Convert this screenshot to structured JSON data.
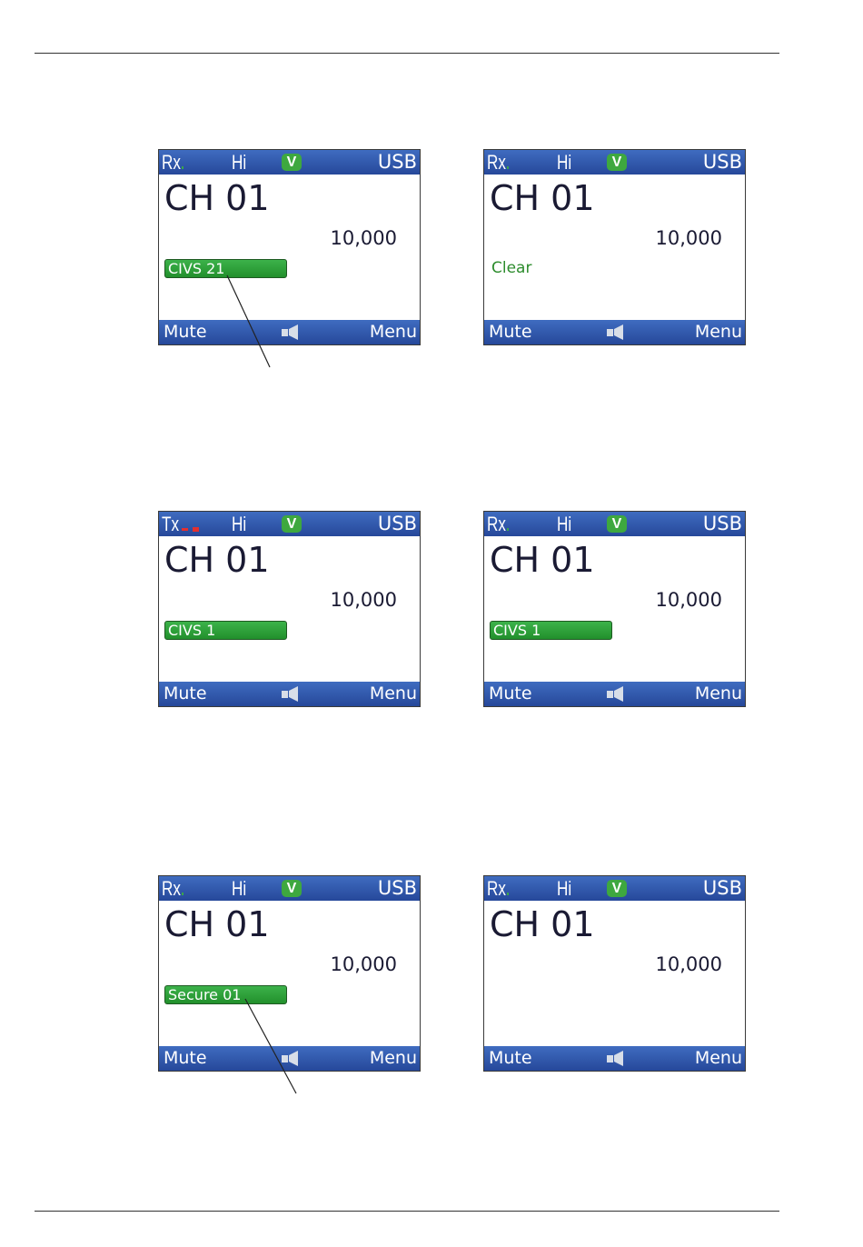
{
  "screens": [
    {
      "mode": "Rx",
      "power": "Hi",
      "v_badge": "V",
      "sideband": "USB",
      "channel": "CH 01",
      "frequency": "10,000",
      "status": "CIVS 21",
      "status_style": "pill",
      "mute": "Mute",
      "menu": "Menu",
      "icon": "speaker-icon"
    },
    {
      "mode": "Rx",
      "power": "Hi",
      "v_badge": "V",
      "sideband": "USB",
      "channel": "CH 01",
      "frequency": "10,000",
      "status": "Clear",
      "status_style": "plain",
      "mute": "Mute",
      "menu": "Menu",
      "icon": "speaker-icon"
    },
    {
      "mode": "Tx",
      "power": "Hi",
      "v_badge": "V",
      "sideband": "USB",
      "channel": "CH 01",
      "frequency": "10,000",
      "status": "CIVS 1",
      "status_style": "pill",
      "mute": "Mute",
      "menu": "Menu",
      "icon": "speaker-icon"
    },
    {
      "mode": "Rx",
      "power": "Hi",
      "v_badge": "V",
      "sideband": "USB",
      "channel": "CH 01",
      "frequency": "10,000",
      "status": "CIVS 1",
      "status_style": "pill",
      "mute": "Mute",
      "menu": "Menu",
      "icon": "speaker-icon"
    },
    {
      "mode": "Rx",
      "power": "Hi",
      "v_badge": "V",
      "sideband": "USB",
      "channel": "CH 01",
      "frequency": "10,000",
      "status": "Secure 01",
      "status_style": "pill",
      "mute": "Mute",
      "menu": "Menu",
      "icon": "speaker-icon"
    },
    {
      "mode": "Rx",
      "power": "Hi",
      "v_badge": "V",
      "sideband": "USB",
      "channel": "CH 01",
      "frequency": "10,000",
      "status": "",
      "status_style": "none",
      "mute": "Mute",
      "menu": "Menu",
      "icon": "speaker-icon"
    }
  ],
  "colors": {
    "bar_blue": "#2f56a8",
    "badge_green": "#3ea83f",
    "status_green": "#2d8c2d",
    "tx_red": "#e23030"
  }
}
